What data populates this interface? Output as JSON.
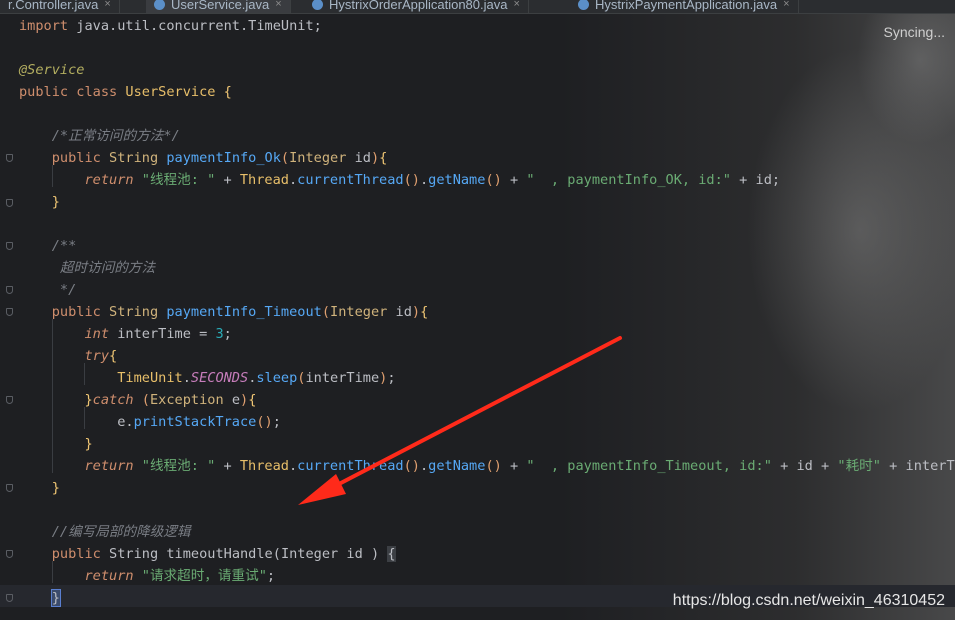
{
  "tabs": [
    {
      "label": "r.Controller.java",
      "active": false
    },
    {
      "label": "UserService.java",
      "active": true
    },
    {
      "label": "HystrixOrderApplication80.java",
      "active": false
    },
    {
      "label": "HystrixPaymentApplication.java",
      "active": false
    }
  ],
  "tab_close_glyph": "×",
  "status": {
    "syncing": "Syncing..."
  },
  "code": {
    "import_kw": "import",
    "import_path": "java.util.concurrent.TimeUnit;",
    "annotation": "@Service",
    "kw_public": "public",
    "kw_class": "class",
    "class_name": "UserService",
    "brace_open": "{",
    "brace_close": "}",
    "comment_normal": "/*正常访问的方法*/",
    "type_string": "String",
    "type_integer": "Integer",
    "method_ok": "paymentInfo_Ok",
    "param_id": "id",
    "kw_return": "return",
    "str_pool": "\"线程池: \"",
    "op_plus": "+",
    "thread_cls": "Thread",
    "current_thread": "currentThread",
    "get_name": "getName",
    "str_ok": "\"  , paymentInfo_OK, id:\"",
    "var_id": "id",
    "javadoc_open": "/**",
    "javadoc_text": "超时访问的方法",
    "javadoc_close": "*/",
    "method_timeout": "paymentInfo_Timeout",
    "kw_int": "int",
    "var_inter": "interTime",
    "num_three": "3",
    "kw_try": "try",
    "timeunit": "TimeUnit",
    "seconds": "SECONDS",
    "sleep": "sleep",
    "kw_catch": "catch",
    "exception": "Exception",
    "var_e": "e",
    "print_stack": "printStackTrace",
    "str_timeout": "\"  , paymentInfo_Timeout, id:\"",
    "str_cost": "\"耗时\"",
    "inter_tail": "interTime",
    "comment_fallback": "//编写局部的降级逻辑",
    "method_handle": "timeoutHandle",
    "str_retry": "\"请求超时，请重试\""
  },
  "watermark": "https://blog.csdn.net/weixin_46310452",
  "colors": {
    "background": "#1e1f22",
    "keyword": "#cf8e6d",
    "string": "#6aab73",
    "method": "#56a8f5",
    "comment": "#7a7e85",
    "arrow": "#ff2a1a"
  }
}
